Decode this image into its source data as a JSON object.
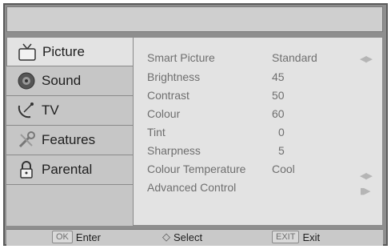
{
  "menu": [
    {
      "label": "Picture",
      "icon": "tv-icon"
    },
    {
      "label": "Sound",
      "icon": "speaker-icon"
    },
    {
      "label": "TV",
      "icon": "satellite-dish-icon"
    },
    {
      "label": "Features",
      "icon": "tools-icon"
    },
    {
      "label": "Parental",
      "icon": "lock-icon"
    }
  ],
  "settings": [
    {
      "label": "Smart Picture",
      "value": "Standard",
      "arrows": "◀▶"
    },
    {
      "label": "Brightness",
      "value": "45"
    },
    {
      "label": "Contrast",
      "value": "50"
    },
    {
      "label": "Colour",
      "value": "60"
    },
    {
      "label": "Tint",
      "value": "0"
    },
    {
      "label": "Sharpness",
      "value": "5"
    },
    {
      "label": "Colour Temperature",
      "value": "Cool",
      "arrows": "◀▶"
    },
    {
      "label": "Advanced Control",
      "value": "",
      "arrows": "▮▶"
    }
  ],
  "footer": {
    "ok_key": "OK",
    "enter": "Enter",
    "select_icon": "◇",
    "select": "Select",
    "exit_key": "EXIT",
    "exit": "Exit"
  }
}
